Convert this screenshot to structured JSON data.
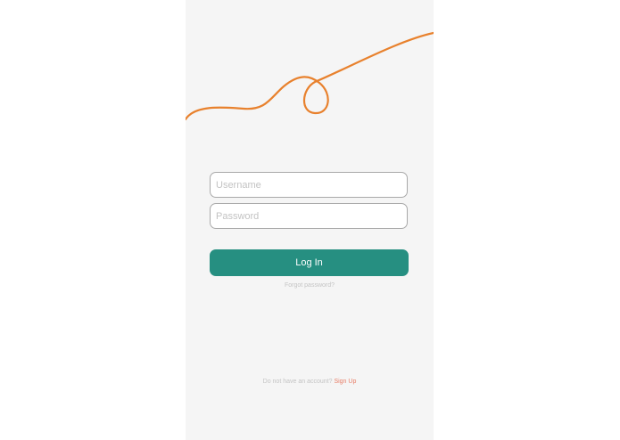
{
  "login_form": {
    "username_placeholder": "Username",
    "password_placeholder": "Password",
    "login_label": "Log In",
    "forgot_label": "Forgot password?"
  },
  "footer": {
    "prompt": "Do not have an account?",
    "signup_label": "Sign Up"
  },
  "colors": {
    "accent_teal": "#268f81",
    "decor_orange": "#e8812d",
    "signup_link": "#e8806a",
    "background": "#f5f5f5"
  }
}
